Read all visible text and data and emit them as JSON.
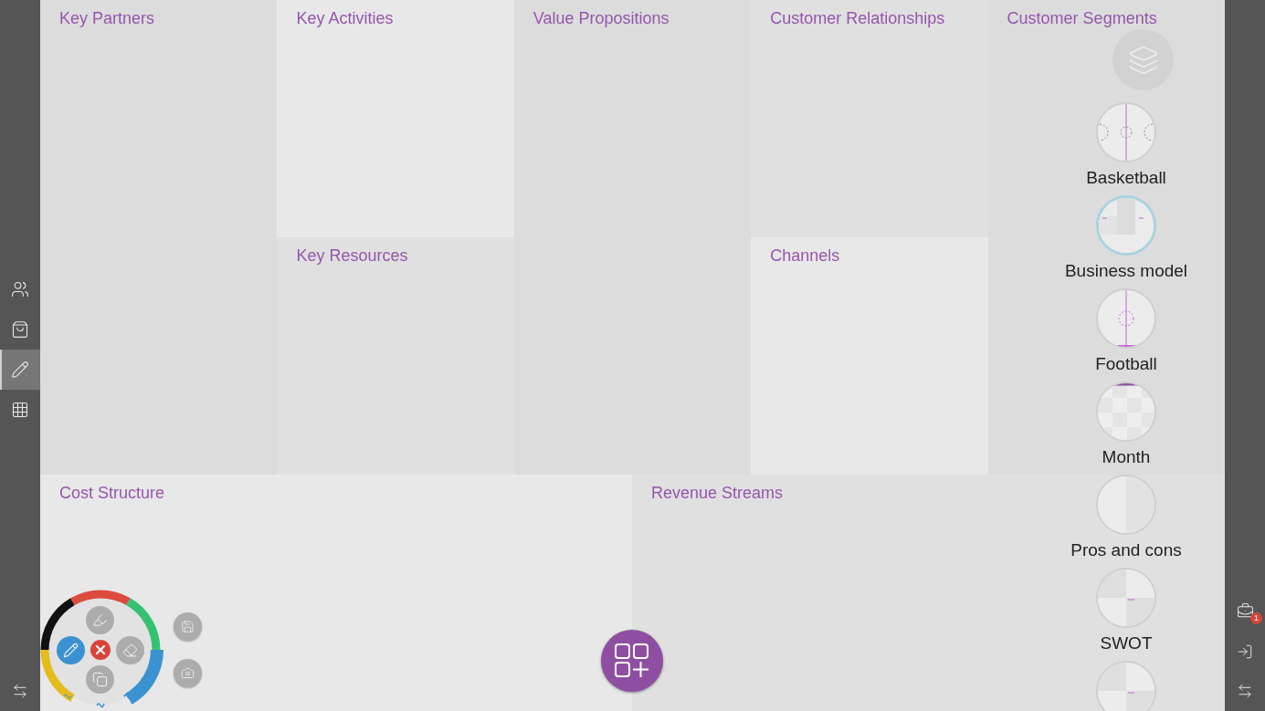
{
  "left_toolbar": {
    "items": [
      {
        "kind": "people",
        "selected": false
      },
      {
        "kind": "bag",
        "selected": false
      },
      {
        "kind": "pencil",
        "selected": true
      },
      {
        "kind": "grid",
        "selected": false
      }
    ]
  },
  "canvas": {
    "columns": [
      {
        "sections": [
          {
            "title": "Key Partners"
          }
        ]
      },
      {
        "sections": [
          {
            "title": "Key Activities"
          },
          {
            "title": "Key Resources"
          }
        ]
      },
      {
        "sections": [
          {
            "title": "Value Propositions"
          }
        ]
      },
      {
        "sections": [
          {
            "title": "Customer Relationships"
          },
          {
            "title": "Channels"
          }
        ]
      },
      {
        "sections": [
          {
            "title": "Customer Segments"
          }
        ]
      }
    ],
    "bottom": [
      {
        "title": "Cost Structure"
      },
      {
        "title": "Revenue Streams"
      }
    ]
  },
  "templates": {
    "items": [
      {
        "kind": "basketball",
        "label": "Basketball",
        "selected": false
      },
      {
        "kind": "business",
        "label": "Business model",
        "selected": true
      },
      {
        "kind": "football",
        "label": "Football",
        "selected": false
      },
      {
        "kind": "month",
        "label": "Month",
        "selected": false
      },
      {
        "kind": "split",
        "label": "Pros and cons",
        "selected": false
      },
      {
        "kind": "quadrants",
        "label": "SWOT",
        "selected": false
      },
      {
        "kind": "quadrants",
        "selected": false
      }
    ]
  },
  "pen_wheel": {
    "colors": [
      {
        "color": "#e5bc1c",
        "selected": false
      },
      {
        "color": "#111111",
        "selected": false
      },
      {
        "color": "#dc4b3e",
        "selected": false
      },
      {
        "color": "#35c172",
        "selected": false
      },
      {
        "color": "#3b92d1",
        "selected": true
      }
    ],
    "tools": [
      {
        "kind": "highlighter",
        "selected": false
      },
      {
        "kind": "pen",
        "selected": true
      },
      {
        "kind": "eraser",
        "selected": false
      },
      {
        "kind": "copy",
        "selected": false
      }
    ],
    "close_button": {
      "kind": "close"
    },
    "side_buttons": [
      {
        "kind": "save"
      },
      {
        "kind": "camera"
      }
    ]
  },
  "add_button": {
    "kind": "add-grid"
  },
  "right_toolbar": {
    "items": [
      {
        "kind": "toolbox",
        "badge": "1"
      },
      {
        "kind": "exit"
      },
      {
        "kind": "swap"
      }
    ]
  }
}
